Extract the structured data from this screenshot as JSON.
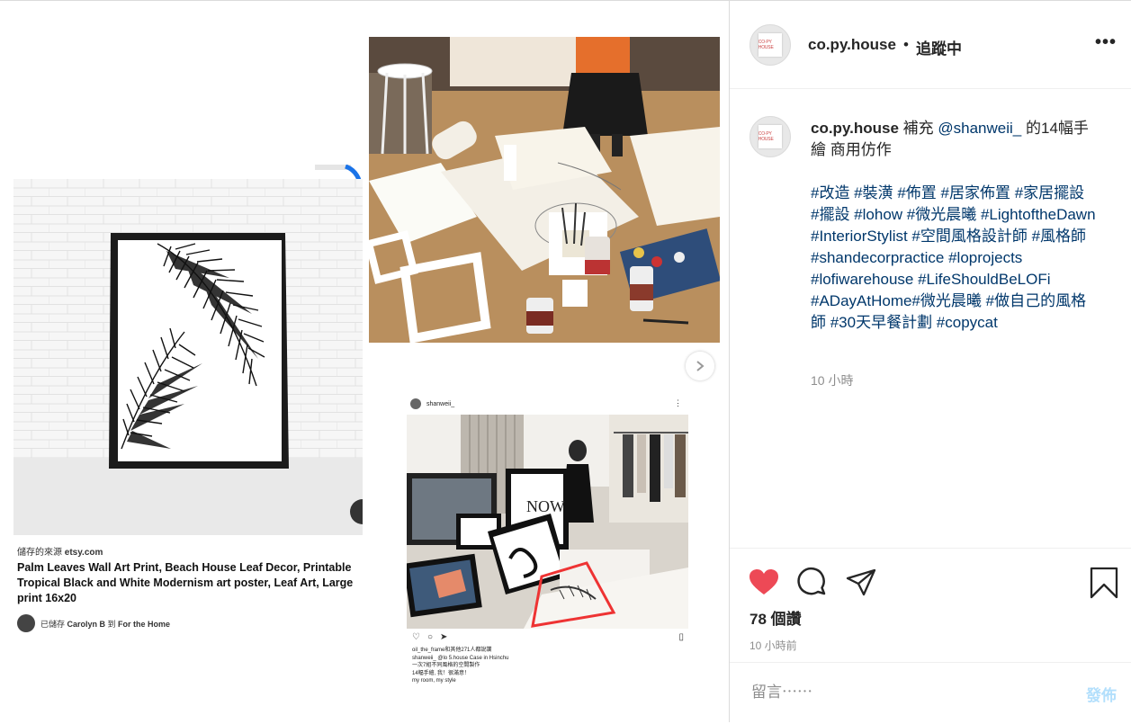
{
  "header": {
    "username": "co.py.house",
    "separator": "•",
    "follow_status": "追蹤中",
    "more_label": "•••"
  },
  "avatar_text": "CO·PY HOUSE",
  "caption": {
    "username": "co.py.house",
    "text_before": " 補充 ",
    "mention": "@shanweii_",
    "text_after": " 的14幅手繪 商用仿作",
    "hashtags": "#改造 #裝潢 #佈置 #居家佈置 #家居擺設 #擺設 #lohow #微光晨曦 #LightoftheDawn #InteriorStylist #空間風格設計師 #風格師 #shandecorpractice #loprojects #lofiwarehouse #LifeShouldBeLOFi #ADayAtHome#微光晨曦 #做自己的風格師 #30天早餐計劃 #copycat",
    "time": "10 小時"
  },
  "actions": {
    "likes": "78 個讚",
    "time": "10 小時前"
  },
  "comment": {
    "placeholder": "留言⋯⋯",
    "post_label": "發佈"
  },
  "pin": {
    "source_prefix": "儲存的來源 ",
    "source_domain": "etsy.com",
    "title": "Palm Leaves Wall Art Print, Beach House Leaf Decor, Printable Tropical Black and White Modernism art poster, Leaf Art, Large print 16x20",
    "saved_prefix": "已儲存 ",
    "saved_user": "Carolyn B",
    "saved_mid": " 到 ",
    "saved_board": "For the Home"
  },
  "ig_shot": {
    "username": "shanweii_",
    "more": "⋮",
    "liked_by": "oil_the_frame和其他271人都說讚",
    "caption_line1": "shanweii_ @lo 5.house  Case in Hsinchu",
    "caption_line2": "一次7組不同風格的空間製作",
    "caption_line3": "14幅手繪, 我！很滿意！",
    "caption_line4": "my room, my style",
    "poster_text": "NOW"
  },
  "colors": {
    "like_red": "#ed4956",
    "link_blue": "#00376b",
    "post_blue": "#b2dffc",
    "muted_gray": "#8e8e8e"
  }
}
